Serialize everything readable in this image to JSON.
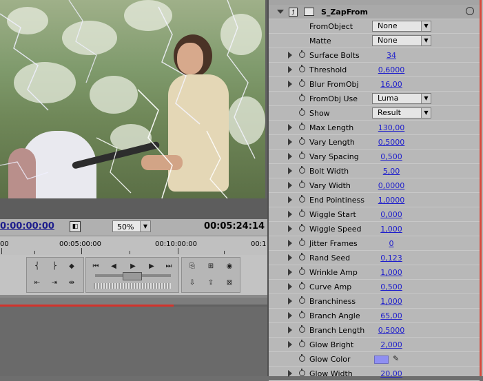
{
  "viewer": {
    "current_time": "0:00:00:00",
    "duration": "00:05:24:14",
    "zoom": "50%",
    "zoom_arrow": "▼"
  },
  "timeline": {
    "ruler_labels": [
      "00",
      "00:05:00:00",
      "00:10:00:00",
      "00:1"
    ]
  },
  "effect": {
    "name": "S_ZapFrom",
    "params": [
      {
        "label": "FromObject",
        "kind": "dropdown",
        "value": "None",
        "twirl": false,
        "stopwatch": false
      },
      {
        "label": "Matte",
        "kind": "dropdown",
        "value": "None",
        "twirl": false,
        "stopwatch": false
      },
      {
        "label": "Surface Bolts",
        "kind": "value",
        "value": "34",
        "twirl": true,
        "stopwatch": true
      },
      {
        "label": "Threshold",
        "kind": "value",
        "value": "0,6000",
        "twirl": true,
        "stopwatch": true
      },
      {
        "label": "Blur FromObj",
        "kind": "value",
        "value": "16,00",
        "twirl": true,
        "stopwatch": true
      },
      {
        "label": "FromObj Use",
        "kind": "dropdown",
        "value": "Luma",
        "twirl": false,
        "stopwatch": true
      },
      {
        "label": "Show",
        "kind": "dropdown",
        "value": "Result",
        "twirl": false,
        "stopwatch": true
      },
      {
        "label": "Max Length",
        "kind": "value",
        "value": "130,00",
        "twirl": true,
        "stopwatch": true
      },
      {
        "label": "Vary Length",
        "kind": "value",
        "value": "0,5000",
        "twirl": true,
        "stopwatch": true
      },
      {
        "label": "Vary Spacing",
        "kind": "value",
        "value": "0,500",
        "twirl": true,
        "stopwatch": true
      },
      {
        "label": "Bolt Width",
        "kind": "value",
        "value": "5,00",
        "twirl": true,
        "stopwatch": true
      },
      {
        "label": "Vary Width",
        "kind": "value",
        "value": "0,0000",
        "twirl": true,
        "stopwatch": true
      },
      {
        "label": "End Pointiness",
        "kind": "value",
        "value": "1,0000",
        "twirl": true,
        "stopwatch": true
      },
      {
        "label": "Wiggle Start",
        "kind": "value",
        "value": "0,000",
        "twirl": true,
        "stopwatch": true
      },
      {
        "label": "Wiggle Speed",
        "kind": "value",
        "value": "1,000",
        "twirl": true,
        "stopwatch": true
      },
      {
        "label": "Jitter Frames",
        "kind": "value",
        "value": "0",
        "twirl": true,
        "stopwatch": true
      },
      {
        "label": "Rand Seed",
        "kind": "value",
        "value": "0,123",
        "twirl": true,
        "stopwatch": true
      },
      {
        "label": "Wrinkle Amp",
        "kind": "value",
        "value": "1,000",
        "twirl": true,
        "stopwatch": true
      },
      {
        "label": "Curve Amp",
        "kind": "value",
        "value": "0,500",
        "twirl": true,
        "stopwatch": true
      },
      {
        "label": "Branchiness",
        "kind": "value",
        "value": "1,000",
        "twirl": true,
        "stopwatch": true
      },
      {
        "label": "Branch Angle",
        "kind": "value",
        "value": "65,00",
        "twirl": true,
        "stopwatch": true
      },
      {
        "label": "Branch Length",
        "kind": "value",
        "value": "0,5000",
        "twirl": true,
        "stopwatch": true
      },
      {
        "label": "Glow Bright",
        "kind": "value",
        "value": "2,000",
        "twirl": true,
        "stopwatch": true
      },
      {
        "label": "Glow Color",
        "kind": "color",
        "value": "#8f8ff2",
        "twirl": false,
        "stopwatch": true
      },
      {
        "label": "Glow Width",
        "kind": "value",
        "value": "20,00",
        "twirl": true,
        "stopwatch": true
      }
    ]
  },
  "icons": {
    "dropdown_arrow": "▼",
    "eyedropper": "✎",
    "fx": "ƒ",
    "toggle": "◧"
  }
}
